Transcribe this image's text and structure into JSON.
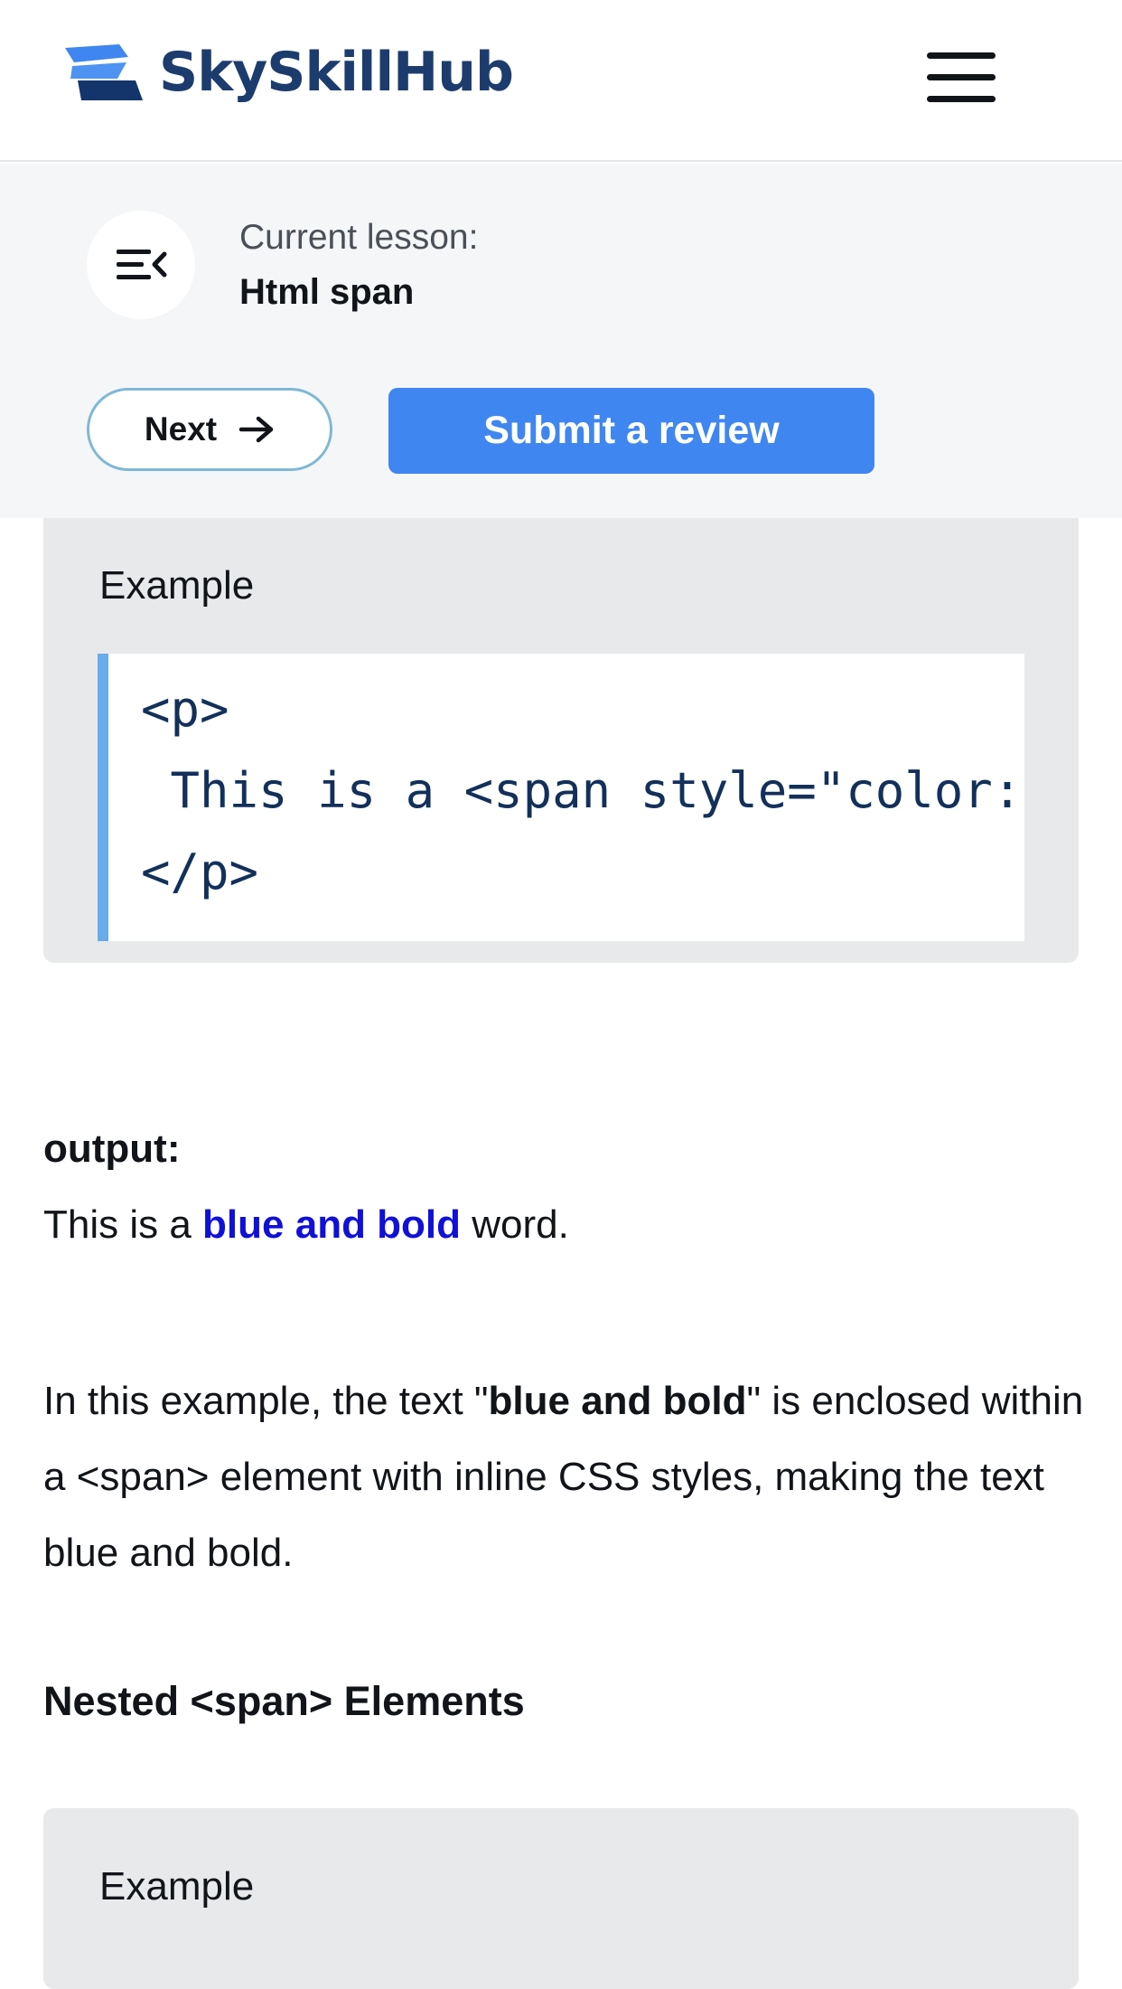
{
  "header": {
    "brand": "SkySkillHub",
    "brand_color": "#1d3c6e",
    "menu_icon": "hamburger-icon"
  },
  "lesson": {
    "label": "Current lesson:",
    "title": "Html span",
    "next_label": "Next",
    "review_label": "Submit a review",
    "accent": "#3f86f0"
  },
  "example1": {
    "label": "Example",
    "code": [
      "<p>",
      " This is a <span style=\"color: blue; font-weight: bold;\">blue and bold</span> word.",
      "</p>"
    ]
  },
  "output": {
    "label": "output:",
    "before": "This is a ",
    "highlight": "blue and bold",
    "after": " word."
  },
  "explanation": {
    "p1": "In this example, the text \"",
    "bold": "blue and bold",
    "p2": "\" is enclosed within a <span> element with inline CSS styles, making the text blue and bold."
  },
  "section": {
    "heading": "Nested <span> Elements"
  },
  "example2": {
    "label": "Example"
  }
}
